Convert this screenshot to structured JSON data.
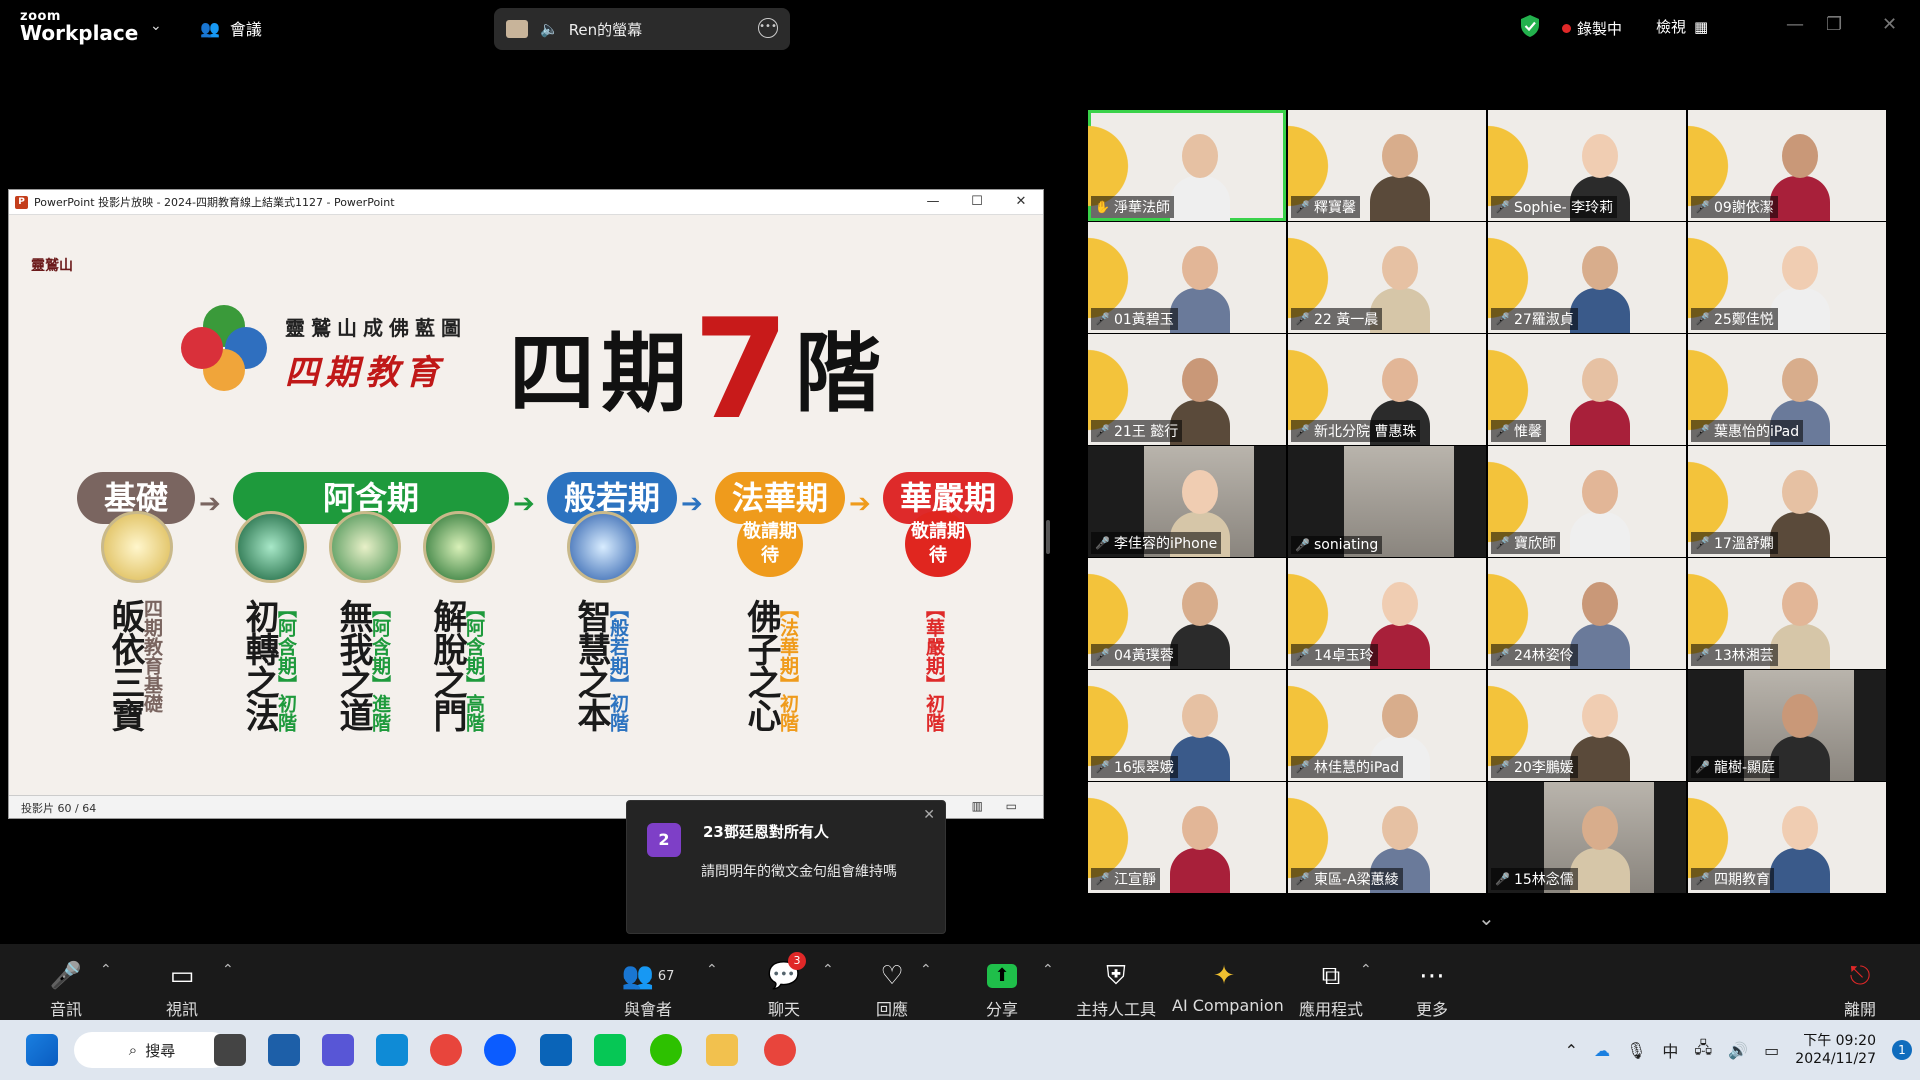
{
  "topbar": {
    "logo_line1": "zoom",
    "logo_line2": "Workplace",
    "meeting_label": "會議",
    "share_label": "Ren的螢幕",
    "recording_label": "錄製中",
    "view_label": "檢視"
  },
  "ppt": {
    "window_title": "PowerPoint 投影片放映 - 2024-四期教育線上結業式1127 - PowerPoint",
    "status_slide": "投影片 60 / 64",
    "slide": {
      "logo_text": "靈鷲山",
      "subtitle_1": "靈鷲山成佛藍圖",
      "subtitle_2": "四期教育",
      "title_pre": "四期",
      "title_num": "7",
      "title_post": "階",
      "stages": [
        "基礎",
        "阿含期",
        "般若期",
        "法華期",
        "華嚴期"
      ],
      "invite_text_1": "敬請期待",
      "invite_text_2": "敬請期待",
      "steps": [
        {
          "main": "皈依三寶",
          "side": "四期教育基礎"
        },
        {
          "main": "初轉之法",
          "side": "【阿含期】初階"
        },
        {
          "main": "無我之道",
          "side": "【阿含期】進階"
        },
        {
          "main": "解脫之門",
          "side": "【阿含期】高階"
        },
        {
          "main": "智慧之本",
          "side": "【般若期】初階"
        },
        {
          "main": "佛子之心",
          "side": "【法華期】初階"
        },
        {
          "main": "",
          "side": "【華嚴期】初階"
        }
      ]
    }
  },
  "participants": [
    "淨華法師",
    "釋寶馨",
    "Sophie- 李玲莉",
    "09謝依潔",
    "01黃碧玉",
    "22 黃一晨",
    "27羅淑貞",
    "25鄭佳悦",
    "21王 懿行",
    "新北分院 曹惠珠",
    "惟馨",
    "葉惠怡的iPad",
    "李佳容的iPhone",
    "soniating",
    "寶欣師",
    "17溫舒嫻",
    "04黃璞蓉",
    "14卓玉玲",
    "24林姿伶",
    "13林湘芸",
    "16張翠娥",
    "林佳慧的iPad",
    "20李鵬媛",
    "龍樹-顯庭",
    "江宣靜",
    "東區-A梁蕙綾",
    "15林念儒",
    "四期教育"
  ],
  "chat_popup": {
    "avatar": "2",
    "from": "23鄧廷恩對所有人",
    "message": "請問明年的徵文金句組會維持嗎"
  },
  "toolbar": {
    "audio": "音訊",
    "video": "視訊",
    "participants": "與會者",
    "participants_count": "67",
    "chat": "聊天",
    "chat_badge": "3",
    "reactions": "回應",
    "share": "分享",
    "host_tools": "主持人工具",
    "ai_companion": "AI Companion",
    "apps": "應用程式",
    "more": "更多",
    "leave": "離開"
  },
  "taskbar": {
    "search": "搜尋",
    "ime": "中",
    "time": "下午 09:20",
    "date": "2024/11/27",
    "notif": "1"
  }
}
